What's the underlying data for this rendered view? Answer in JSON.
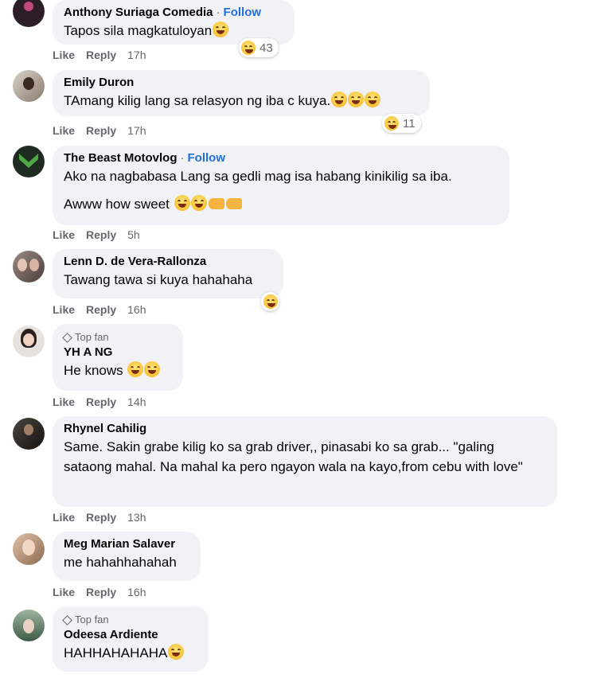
{
  "actions": {
    "like": "Like",
    "reply": "Reply"
  },
  "badges": {
    "top_fan": "Top fan",
    "follow": "Follow"
  },
  "comments": [
    {
      "author": "Anthony Suriaga Comedia",
      "follow": true,
      "text": "Tapos sila magkatuloyan",
      "time": "17h",
      "reaction_count": "43"
    },
    {
      "author": "Emily Duron",
      "text": "TAmang kilig lang sa relasyon ng iba c kuya.",
      "time": "17h",
      "reaction_count": "11"
    },
    {
      "author": "The Beast Motovlog",
      "follow": true,
      "text": "Ako na nagbabasa Lang sa gedli mag isa habang kinikilig sa iba.",
      "text2": "Awww how sweet",
      "time": "5h"
    },
    {
      "author": "Lenn D. de Vera-Rallonza",
      "text": "Tawang tawa si kuya hahahaha",
      "time": "16h"
    },
    {
      "author": "YH A NG",
      "top_fan": true,
      "text": "He knows",
      "time": "14h"
    },
    {
      "author": "Rhynel Cahilig",
      "text": "Same. Sakin grabe kilig ko sa grab driver,, pinasabi ko sa grab... \"galing sataong mahal. Na mahal ka pero ngayon wala na kayo,from cebu with love\"",
      "time": "13h"
    },
    {
      "author": "Meg Marian Salaver",
      "text": "me hahahhahahah",
      "time": "16h"
    },
    {
      "author": "Odeesa Ardiente",
      "top_fan": true,
      "text": "HAHHAHAHAHA",
      "time": ""
    }
  ]
}
